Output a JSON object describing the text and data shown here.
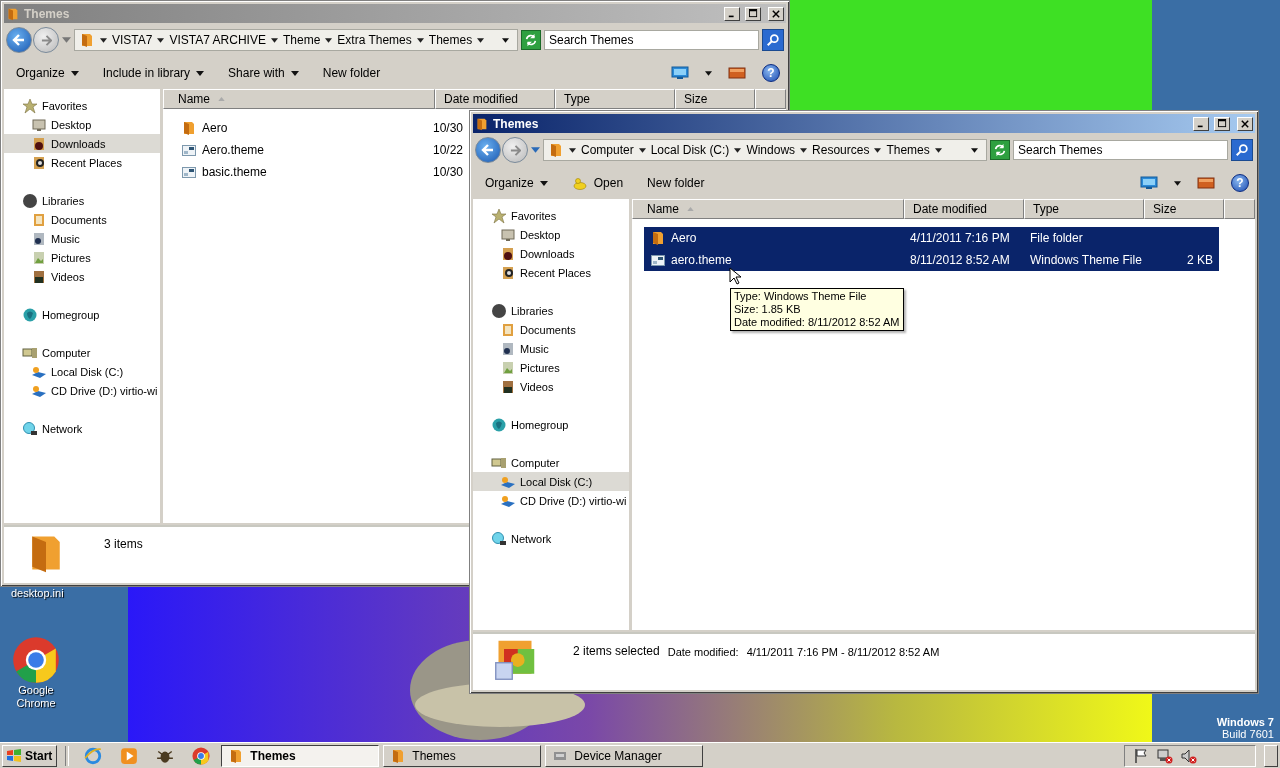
{
  "desktop": {
    "icons": [
      {
        "label": "desktop.ini",
        "kind": "file"
      },
      {
        "label": "Google Chrome",
        "kind": "browser"
      }
    ],
    "watermark": [
      "Windows 7",
      "Build 7601"
    ]
  },
  "windows": [
    {
      "title": "Themes",
      "active": false,
      "breadcrumbs": [
        "VISTA7",
        "VISTA7 ARCHIVE",
        "Theme",
        "Extra Themes",
        "Themes"
      ],
      "search": {
        "placeholder": "Search Themes"
      },
      "toolbar": [
        {
          "label": "Organize",
          "kind": "menu"
        },
        {
          "label": "Include in library",
          "kind": "menu"
        },
        {
          "label": "Share with",
          "kind": "menu"
        },
        {
          "label": "New folder",
          "kind": "plain"
        }
      ],
      "help": "?",
      "nav": [
        {
          "label": "Favorites",
          "kind": "favorites",
          "selected": false,
          "children": [
            {
              "label": "Desktop",
              "kind": "desktop",
              "selected": false
            },
            {
              "label": "Downloads",
              "kind": "downloads",
              "selected": true
            },
            {
              "label": "Recent Places",
              "kind": "recent",
              "selected": false
            }
          ]
        },
        {
          "label": "Libraries",
          "kind": "libraries",
          "selected": false,
          "children": [
            {
              "label": "Documents",
              "kind": "documents",
              "selected": false
            },
            {
              "label": "Music",
              "kind": "music",
              "selected": false
            },
            {
              "label": "Pictures",
              "kind": "pictures",
              "selected": false
            },
            {
              "label": "Videos",
              "kind": "videos",
              "selected": false
            }
          ]
        },
        {
          "label": "Homegroup",
          "kind": "homegroup",
          "selected": false
        },
        {
          "label": "Computer",
          "kind": "computer",
          "selected": false,
          "children": [
            {
              "label": "Local Disk (C:)",
              "kind": "disk",
              "selected": false
            },
            {
              "label": "CD Drive (D:) virtio-wi",
              "kind": "cd",
              "selected": false
            }
          ]
        },
        {
          "label": "Network",
          "kind": "network",
          "selected": false
        }
      ],
      "columns": [
        "Name",
        "Date modified",
        "Type",
        "Size"
      ],
      "rows": [
        {
          "name": "Aero",
          "kind": "folder",
          "date": "10/30",
          "selected": false
        },
        {
          "name": "Aero.theme",
          "kind": "theme",
          "date": "10/22",
          "selected": false
        },
        {
          "name": "basic.theme",
          "kind": "theme",
          "date": "10/30",
          "selected": false
        }
      ],
      "status": {
        "kind": "folder",
        "text": "3 items"
      }
    },
    {
      "title": "Themes",
      "active": true,
      "breadcrumbs": [
        "Computer",
        "Local Disk (C:)",
        "Windows",
        "Resources",
        "Themes"
      ],
      "search": {
        "placeholder": "Search Themes"
      },
      "toolbar": [
        {
          "label": "Organize",
          "kind": "menu"
        },
        {
          "label": "Open",
          "kind": "open"
        },
        {
          "label": "New folder",
          "kind": "plain"
        }
      ],
      "help": "?",
      "nav": [
        {
          "label": "Favorites",
          "kind": "favorites",
          "selected": false,
          "children": [
            {
              "label": "Desktop",
              "kind": "desktop",
              "selected": false
            },
            {
              "label": "Downloads",
              "kind": "downloads",
              "selected": false
            },
            {
              "label": "Recent Places",
              "kind": "recent",
              "selected": false
            }
          ]
        },
        {
          "label": "Libraries",
          "kind": "libraries",
          "selected": false,
          "children": [
            {
              "label": "Documents",
              "kind": "documents",
              "selected": false
            },
            {
              "label": "Music",
              "kind": "music",
              "selected": false
            },
            {
              "label": "Pictures",
              "kind": "pictures",
              "selected": false
            },
            {
              "label": "Videos",
              "kind": "videos",
              "selected": false
            }
          ]
        },
        {
          "label": "Homegroup",
          "kind": "homegroup",
          "selected": false
        },
        {
          "label": "Computer",
          "kind": "computer",
          "selected": false,
          "children": [
            {
              "label": "Local Disk (C:)",
              "kind": "disk",
              "selected": true
            },
            {
              "label": "CD Drive (D:) virtio-wi",
              "kind": "cd",
              "selected": false
            }
          ]
        },
        {
          "label": "Network",
          "kind": "network",
          "selected": false
        }
      ],
      "columns": [
        "Name",
        "Date modified",
        "Type",
        "Size"
      ],
      "rows": [
        {
          "name": "Aero",
          "kind": "folder",
          "date": "4/11/2011 7:16 PM",
          "type": "File folder",
          "selected": true
        },
        {
          "name": "aero.theme",
          "kind": "theme",
          "date": "8/11/2012 8:52 AM",
          "type": "Windows Theme File",
          "size": "2 KB",
          "selected": true
        }
      ],
      "tooltip": [
        "Type: Windows Theme File",
        "Size: 1.85 KB",
        "Date modified: 8/11/2012 8:52 AM"
      ],
      "status": {
        "kind": "selection",
        "text": "2 items selected",
        "label": "Date modified:",
        "value": "4/11/2011 7:16 PM - 8/11/2012 8:52 AM"
      }
    }
  ],
  "taskbar": {
    "start": "Start",
    "tasks": [
      {
        "label": "Themes",
        "kind": "folder",
        "selected": true
      },
      {
        "label": "Themes",
        "kind": "folder",
        "selected": false
      },
      {
        "label": "Device Manager",
        "kind": "devices",
        "selected": false
      }
    ]
  }
}
